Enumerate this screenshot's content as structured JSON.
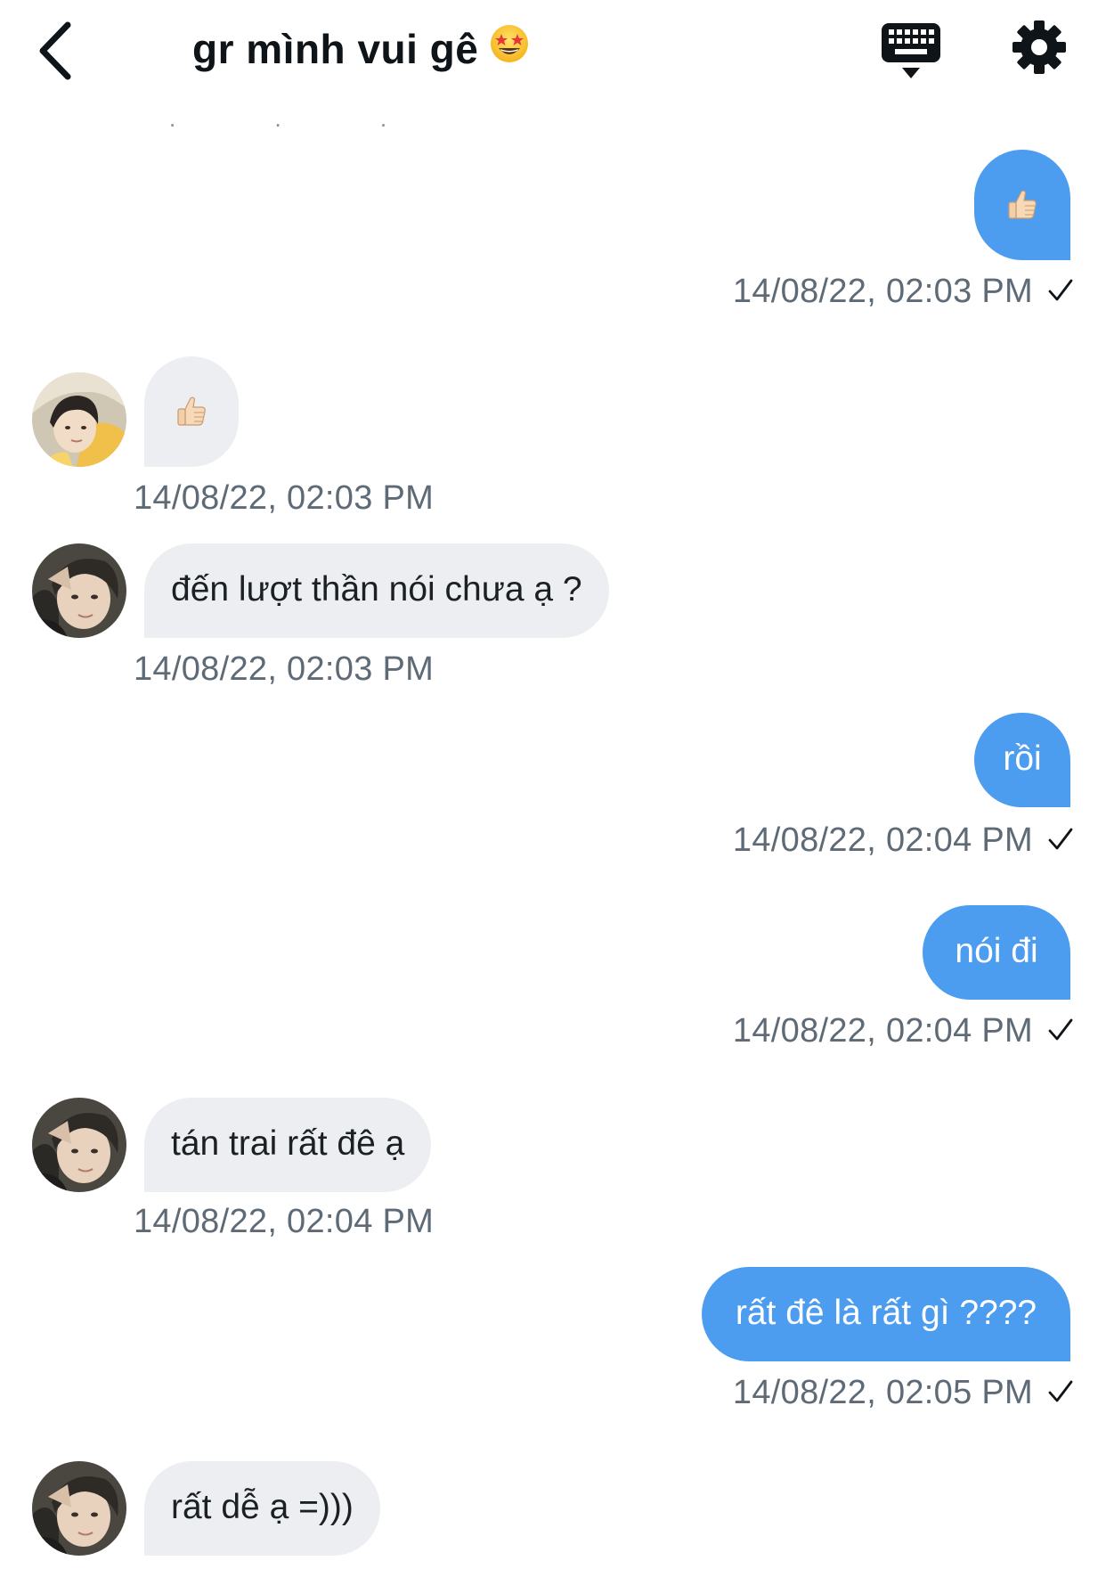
{
  "header": {
    "title": "gr mình vui gê",
    "title_emoji": "star-struck-emoji-icon",
    "back_icon": "chevron-left-icon",
    "keyboard_icon": "keyboard-icon",
    "settings_icon": "gear-icon"
  },
  "typing_indicator": ". . .",
  "colors": {
    "outgoing_bubble": "#4c9df0",
    "incoming_bubble": "#eceef1",
    "timestamp": "#5e6a75",
    "text": "#0f1419"
  },
  "messages": [
    {
      "direction": "out",
      "type": "emoji",
      "content": "thumbs-up-emoji-icon",
      "timestamp": "14/08/22, 02:03 PM",
      "status_icon": "checkmark-icon"
    },
    {
      "direction": "in",
      "type": "emoji",
      "avatar": "avatar-member-a",
      "content": "thumbs-up-emoji-icon",
      "timestamp": "14/08/22, 02:03 PM"
    },
    {
      "direction": "in",
      "type": "text",
      "avatar": "avatar-member-b",
      "text": "đến lượt thần nói chưa ạ ?",
      "timestamp": "14/08/22, 02:03 PM"
    },
    {
      "direction": "out",
      "type": "text",
      "text": "rồi",
      "timestamp": "14/08/22, 02:04 PM",
      "status_icon": "checkmark-icon"
    },
    {
      "direction": "out",
      "type": "text",
      "text": "nói đi",
      "timestamp": "14/08/22, 02:04 PM",
      "status_icon": "checkmark-icon"
    },
    {
      "direction": "in",
      "type": "text",
      "avatar": "avatar-member-b",
      "text": "tán trai rất đê ạ",
      "timestamp": "14/08/22, 02:04 PM"
    },
    {
      "direction": "out",
      "type": "text",
      "text": "rất đê là rất gì ????",
      "timestamp": "14/08/22, 02:05 PM",
      "status_icon": "checkmark-icon"
    },
    {
      "direction": "in",
      "type": "text",
      "avatar": "avatar-member-b",
      "text": "rất dễ ạ =)))"
    }
  ]
}
